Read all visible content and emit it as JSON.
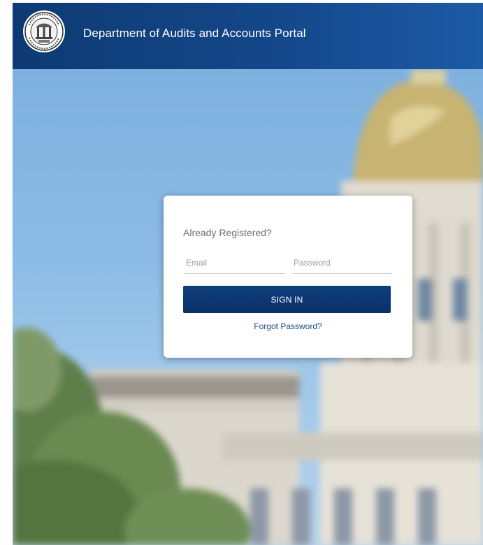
{
  "header": {
    "title": "Department of Audits and Accounts Portal",
    "logo": "state-seal"
  },
  "login": {
    "heading": "Already Registered?",
    "email_placeholder": "Email",
    "email_value": "",
    "password_placeholder": "Password",
    "password_value": "",
    "signin_label": "SIGN IN",
    "forgot_label": "Forgot Password?"
  },
  "colors": {
    "header": "#14478a",
    "button": "#0f3f7c",
    "link": "#1a4a8a"
  }
}
